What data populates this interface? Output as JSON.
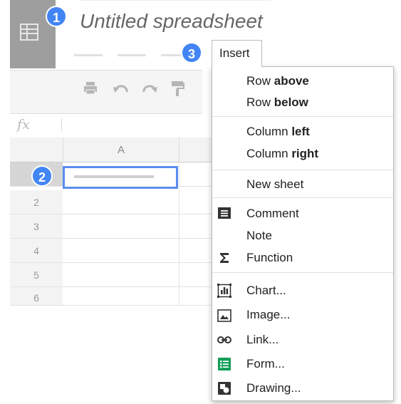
{
  "document": {
    "title": "Untitled spreadsheet"
  },
  "badges": {
    "title_step": "1",
    "cell_step": "2",
    "insert_step": "3"
  },
  "menu_bar": {
    "insert_label": "Insert"
  },
  "formula_bar": {
    "fx_label": "fx"
  },
  "grid": {
    "column_header": "A",
    "rows": [
      "2",
      "3",
      "4",
      "5",
      "6"
    ]
  },
  "insert_menu": {
    "row_above": {
      "prefix": "Row ",
      "bold": "above"
    },
    "row_below": {
      "prefix": "Row ",
      "bold": "below"
    },
    "column_left": {
      "prefix": "Column ",
      "bold": "left"
    },
    "column_right": {
      "prefix": "Column ",
      "bold": "right"
    },
    "new_sheet": "New sheet",
    "comment": "Comment",
    "note": "Note",
    "function": "Function",
    "chart": "Chart...",
    "image": "Image...",
    "link": "Link...",
    "form": "Form...",
    "drawing": "Drawing..."
  },
  "icons": {
    "comment": "comment-icon",
    "function": "sigma-icon",
    "chart": "chart-icon",
    "image": "image-icon",
    "link": "link-icon",
    "form": "form-icon",
    "drawing": "drawing-icon"
  },
  "colors": {
    "badge_blue": "#4285f4",
    "selection_blue": "#5b8dee",
    "form_green": "#0f9d58",
    "logo_gray": "#9e9e9e"
  }
}
